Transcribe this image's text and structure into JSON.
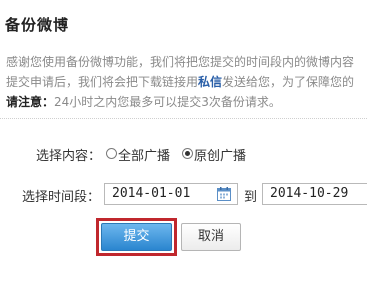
{
  "dialog": {
    "title": "备份微博"
  },
  "description": {
    "line1": "感谢您使用备份微博功能，我们将把您提交的时间段内的微博内容",
    "line2_before": "提交申请后，我们将会把下载链接用",
    "line2_highlight": "私信",
    "line2_after": "发送给您，为了保障您的",
    "note_label": "请注意：",
    "note_text": "24小时之内您最多可以提交3次备份请求。"
  },
  "content_select": {
    "label": "选择内容：",
    "options": [
      {
        "label": "全部广播",
        "checked": false
      },
      {
        "label": "原创广播",
        "checked": true
      }
    ]
  },
  "time_select": {
    "label": "选择时间段：",
    "start_date": "2014-01-01",
    "separator": "到",
    "end_date": "2014-10-29"
  },
  "buttons": {
    "submit": "提交",
    "cancel": "取消"
  },
  "colors": {
    "highlight_link": "#2a5fa8",
    "submit_button": "#2a85cf",
    "annotation_box": "#c0272d"
  }
}
